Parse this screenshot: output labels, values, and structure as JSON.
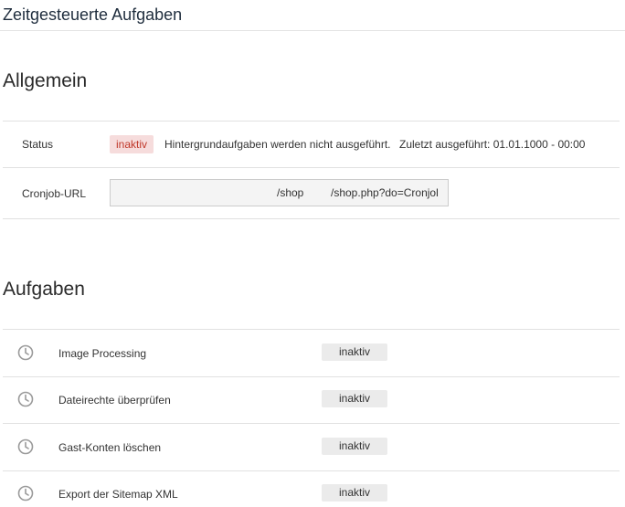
{
  "header": {
    "title": "Zeitgesteuerte Aufgaben"
  },
  "general": {
    "title": "Allgemein",
    "status": {
      "label": "Status",
      "badge": "inaktiv",
      "text": "Hintergrundaufgaben werden nicht ausgeführt.",
      "last_run": "Zuletzt ausgeführt: 01.01.1000 - 00:00"
    },
    "cronjob": {
      "label": "Cronjob-URL",
      "value_part1": "/shop",
      "value_part2": "/shop.php?do=Cronjol"
    }
  },
  "tasks": {
    "title": "Aufgaben",
    "items": [
      {
        "name": "Image Processing",
        "status": "inaktiv",
        "icon": "clock-icon"
      },
      {
        "name": "Dateirechte überprüfen",
        "status": "inaktiv",
        "icon": "clock-icon"
      },
      {
        "name": "Gast-Konten löschen",
        "status": "inaktiv",
        "icon": "clock-icon"
      },
      {
        "name": "Export der Sitemap XML",
        "status": "inaktiv",
        "icon": "clock-icon"
      }
    ]
  },
  "colors": {
    "inactive_badge_bg": "#f6dcdc",
    "inactive_badge_text": "#c0392b",
    "task_badge_bg": "#ebebeb"
  }
}
